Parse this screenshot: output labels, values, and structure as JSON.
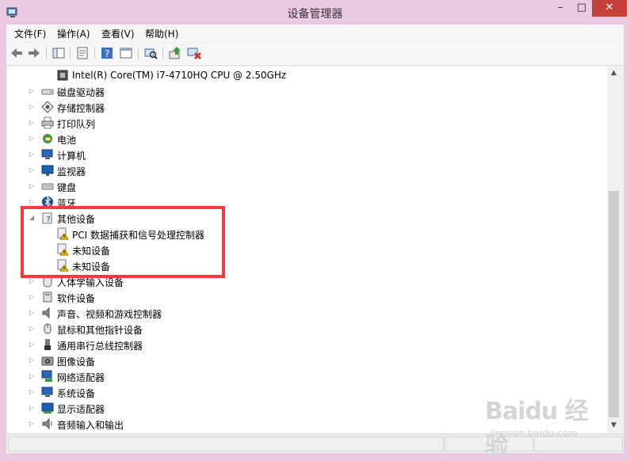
{
  "window": {
    "title": "设备管理器",
    "min_glyph": "–",
    "max_glyph": "□",
    "close_glyph": "✕"
  },
  "menu": [
    "文件(F)",
    "操作(A)",
    "查看(V)",
    "帮助(H)"
  ],
  "toolbar": [
    "back-icon",
    "forward-icon",
    "console-tree-icon",
    "properties-icon",
    "help-icon",
    "view-icon",
    "scan-hardware-icon",
    "update-driver-icon",
    "uninstall-icon"
  ],
  "tree": [
    {
      "label": "Intel(R) Core(TM) i7-4710HQ CPU @ 2.50GHz",
      "level": 2,
      "icon": "processor-icon",
      "expander": ""
    },
    {
      "label": "磁盘驱动器",
      "level": 1,
      "icon": "disk-drive-icon",
      "expander": "▷"
    },
    {
      "label": "存储控制器",
      "level": 1,
      "icon": "storage-controller-icon",
      "expander": "▷"
    },
    {
      "label": "打印队列",
      "level": 1,
      "icon": "printer-icon",
      "expander": "▷"
    },
    {
      "label": "电池",
      "level": 1,
      "icon": "battery-icon",
      "expander": "▷"
    },
    {
      "label": "计算机",
      "level": 1,
      "icon": "computer-icon",
      "expander": "▷"
    },
    {
      "label": "监视器",
      "level": 1,
      "icon": "monitor-icon",
      "expander": "▷"
    },
    {
      "label": "键盘",
      "level": 1,
      "icon": "keyboard-icon",
      "expander": "▷"
    },
    {
      "label": "蓝牙",
      "level": 1,
      "icon": "bluetooth-icon",
      "expander": "▷"
    },
    {
      "label": "其他设备",
      "level": 1,
      "icon": "unknown-device-icon",
      "expander": "◢"
    },
    {
      "label": "PCI 数据捕获和信号处理控制器",
      "level": 2,
      "icon": "warning-device-icon",
      "expander": ""
    },
    {
      "label": "未知设备",
      "level": 2,
      "icon": "warning-device-icon",
      "expander": ""
    },
    {
      "label": "未知设备",
      "level": 2,
      "icon": "warning-device-icon",
      "expander": ""
    },
    {
      "label": "人体学输入设备",
      "level": 1,
      "icon": "hid-icon",
      "expander": "▷"
    },
    {
      "label": "软件设备",
      "level": 1,
      "icon": "software-device-icon",
      "expander": "▷"
    },
    {
      "label": "声音、视频和游戏控制器",
      "level": 1,
      "icon": "sound-icon",
      "expander": "▷"
    },
    {
      "label": "鼠标和其他指针设备",
      "level": 1,
      "icon": "mouse-icon",
      "expander": "▷"
    },
    {
      "label": "通用串行总线控制器",
      "level": 1,
      "icon": "usb-icon",
      "expander": "▷"
    },
    {
      "label": "图像设备",
      "level": 1,
      "icon": "camera-icon",
      "expander": "▷"
    },
    {
      "label": "网络适配器",
      "level": 1,
      "icon": "network-adapter-icon",
      "expander": "▷"
    },
    {
      "label": "系统设备",
      "level": 1,
      "icon": "system-device-icon",
      "expander": "▷"
    },
    {
      "label": "显示适配器",
      "level": 1,
      "icon": "display-adapter-icon",
      "expander": "▷"
    },
    {
      "label": "音频输入和输出",
      "level": 1,
      "icon": "audio-io-icon",
      "expander": "▷"
    }
  ],
  "scrollbar": {
    "up_glyph": "▲",
    "down_glyph": "▼"
  },
  "watermark": {
    "logo": "Baidu 经验",
    "url": "jingyan.baidu.com"
  },
  "colors": {
    "frame": "#ecc9e3",
    "highlight": "#ef3d3d",
    "close": "#c7403a"
  }
}
